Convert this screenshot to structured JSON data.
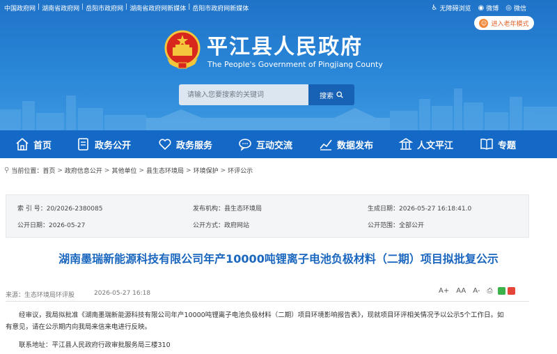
{
  "header": {
    "top_links": [
      "中国政府网",
      "湖南省政府网",
      "岳阳市政府网",
      "湖南省政府网新媒体",
      "岳阳市政府网新媒体"
    ],
    "separator": "|",
    "accessibility": "无障碍浏览",
    "weibo": "微博",
    "wechat": "微信",
    "elder_mode": "进入老年模式",
    "site_title": "平江县人民政府",
    "site_subtitle": "The People's Government of Pingjiang County",
    "search_placeholder": "请输入您要搜索的关键词",
    "search_button": "搜索"
  },
  "nav": {
    "items": [
      "首页",
      "政务公开",
      "政务服务",
      "互动交流",
      "数据发布",
      "人文平江",
      "专题"
    ]
  },
  "breadcrumb": {
    "prefix": "当前位置：",
    "items": [
      "首页",
      "政府信息公开",
      "其他单位",
      "县生态环境局",
      "环境保护",
      "环评公示"
    ],
    "separator": ">"
  },
  "meta": {
    "index_label": "索 引 号：",
    "index_value": "20/2026-2380085",
    "org_label": "发布机构：",
    "org_value": "县生态环境局",
    "created_label": "生成日期：",
    "created_value": "2026-05-27 16:18:41.0",
    "public_date_label": "公开日期：",
    "public_date_value": "2026-05-27",
    "method_label": "公开方式：",
    "method_value": "政府网站",
    "scope_label": "公开范围：",
    "scope_value": "全部公开"
  },
  "article": {
    "title": "湖南墨瑞新能源科技有限公司年产10000吨锂离子电池负极材料（二期）项目拟批复公示",
    "source": "来源：生态环境局环评股",
    "datetime": "2026-05-27 16:18",
    "font_large": "A+",
    "font_medium": "AA",
    "font_small": "A-",
    "paragraph1_line1": "经审议，我局拟批准《湖南墨瑞新能源科技有限公司年产10000吨锂离子电池负极材料（二期）项目环境影响报告表》，现就项目环评相关情况予以公示5个工作日。如",
    "paragraph1_line2": "有意见，请在公示期内向我局来信来电进行反映。",
    "address": "联系地址：平江县人民政府行政审批服务局三楼310"
  },
  "colors": {
    "banner": "#2a86d8",
    "nav": "#1468c6",
    "title": "#1b67bf",
    "elder": "#e0642a"
  }
}
